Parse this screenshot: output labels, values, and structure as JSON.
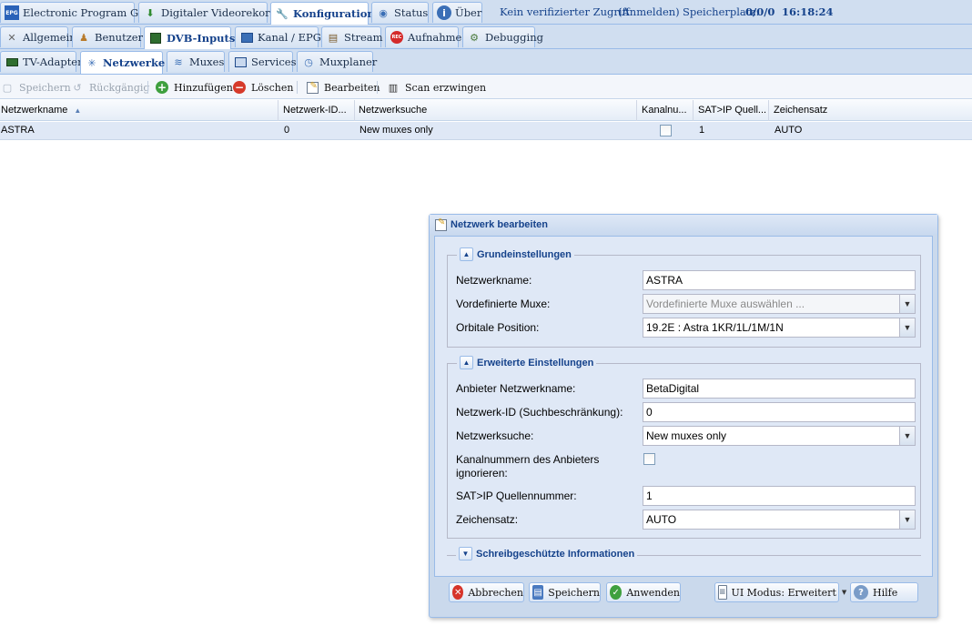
{
  "top_tabs": [
    {
      "label": "Electronic Program Guide",
      "icon": "epg-icon"
    },
    {
      "label": "Digitaler Videorekorder",
      "icon": "download-icon"
    },
    {
      "label": "Konfiguration",
      "icon": "wrench-icon"
    },
    {
      "label": "Status",
      "icon": "eye-icon"
    },
    {
      "label": "Über",
      "icon": "info-icon"
    }
  ],
  "top_info": {
    "access": "Kein verifizierter Zugriff",
    "login": "(Anmelden)",
    "storage_label": "Speicherplatz:",
    "storage_value": "0/0/0",
    "time": "16:18:24"
  },
  "config_tabs": [
    {
      "label": "Allgemein",
      "icon": "tools-icon"
    },
    {
      "label": "Benutzer",
      "icon": "users-icon"
    },
    {
      "label": "DVB-Inputs",
      "icon": "dvb-card-icon"
    },
    {
      "label": "Kanal / EPG",
      "icon": "tv-icon"
    },
    {
      "label": "Stream",
      "icon": "stream-icon"
    },
    {
      "label": "Aufnahme",
      "icon": "record-icon"
    },
    {
      "label": "Debugging",
      "icon": "bug-icon"
    }
  ],
  "dvb_tabs": [
    {
      "label": "TV-Adapter",
      "icon": "adapter-icon"
    },
    {
      "label": "Netzwerke",
      "icon": "antenna-icon"
    },
    {
      "label": "Muxes",
      "icon": "muxes-icon"
    },
    {
      "label": "Services",
      "icon": "services-icon"
    },
    {
      "label": "Muxplaner",
      "icon": "clock-icon"
    }
  ],
  "toolbar": {
    "save": "Speichern",
    "undo": "Rückgängig",
    "add": "Hinzufügen",
    "delete": "Löschen",
    "edit": "Bearbeiten",
    "scan": "Scan erzwingen"
  },
  "grid": {
    "columns": [
      "Netzwerkname",
      "Netzwerk-ID...",
      "Netzwerksuche",
      "Kanalnu...",
      "SAT>IP Quell...",
      "Zeichensatz"
    ],
    "sort_indicator": "▲",
    "rows": [
      {
        "name": "ASTRA",
        "network_id": "0",
        "search": "New muxes only",
        "ignore_numbers": false,
        "satip_source": "1",
        "charset": "AUTO"
      }
    ]
  },
  "dialog": {
    "title": "Netzwerk bearbeiten",
    "basic": {
      "legend": "Grundeinstellungen",
      "name_label": "Netzwerkname:",
      "name_value": "ASTRA",
      "muxes_label": "Vordefinierte Muxe:",
      "muxes_placeholder": "Vordefinierte Muxe auswählen ...",
      "orbital_label": "Orbitale Position:",
      "orbital_value": "19.2E : Astra 1KR/1L/1M/1N"
    },
    "advanced": {
      "legend": "Erweiterte Einstellungen",
      "provider_label": "Anbieter Netzwerkname:",
      "provider_value": "BetaDigital",
      "netid_label": "Netzwerk-ID (Suchbeschränkung):",
      "netid_value": "0",
      "search_label": "Netzwerksuche:",
      "search_value": "New muxes only",
      "ignore_label_1": "Kanalnummern des Anbieters",
      "ignore_label_2": "ignorieren:",
      "ignore_checked": false,
      "satip_label": "SAT>IP Quellennummer:",
      "satip_value": "1",
      "charset_label": "Zeichensatz:",
      "charset_value": "AUTO"
    },
    "readonly": {
      "legend": "Schreibgeschützte Informationen"
    },
    "buttons": {
      "cancel": "Abbrechen",
      "save": "Speichern",
      "apply": "Anwenden",
      "ui_mode": "UI Modus: Erweitert",
      "help": "Hilfe"
    }
  },
  "colors": {
    "accent": "#15428b",
    "tab_bg": "#d0def0",
    "row_selected": "#dfe8f6",
    "dialog_bg": "#cad9ec"
  }
}
